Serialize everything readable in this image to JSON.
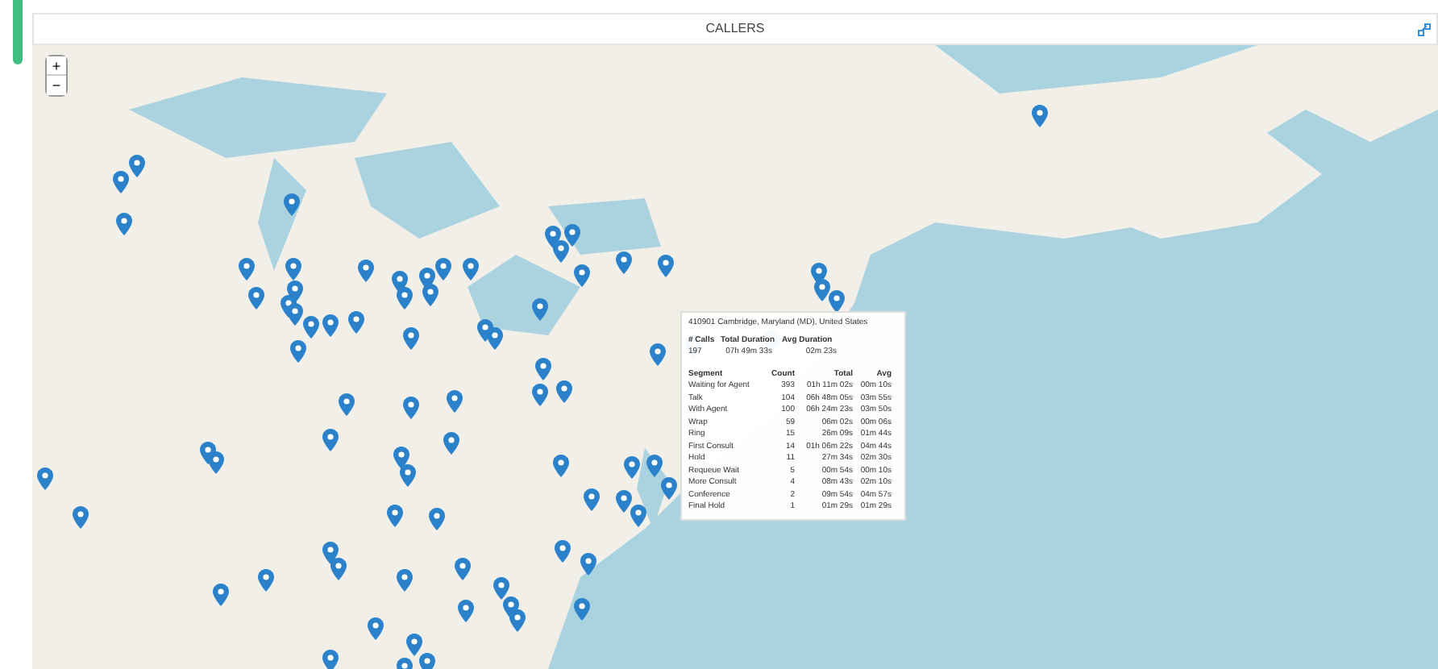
{
  "panel": {
    "title": "CALLERS"
  },
  "map_controls": [
    "+",
    "−"
  ],
  "tooltip": {
    "location": "410901 Cambridge, Maryland (MD), United States",
    "summary_columns": [
      "# Calls",
      "Total Duration",
      "Avg Duration"
    ],
    "summary_values": [
      "197",
      "07h 49m 33s",
      "02m 23s"
    ],
    "segment_columns": [
      "Segment",
      "Count",
      "Total",
      "Avg"
    ],
    "segments": [
      [
        "Waiting for Agent",
        "393",
        "01h 11m 02s",
        "00m 10s"
      ],
      [
        "Talk",
        "104",
        "06h 48m 05s",
        "03m 55s"
      ],
      [
        "With Agent",
        "100",
        "06h 24m 23s",
        "03m 50s"
      ],
      [
        "Wrap",
        "59",
        "06m 02s",
        "00m 06s"
      ],
      [
        "Ring",
        "15",
        "26m 09s",
        "01m 44s"
      ],
      [
        "First Consult",
        "14",
        "01h 06m 22s",
        "04m 44s"
      ],
      [
        "Hold",
        "11",
        "27m 34s",
        "02m 30s"
      ],
      [
        "Requeue Wait",
        "5",
        "00m 54s",
        "00m 10s"
      ],
      [
        "More Consult",
        "4",
        "08m 43s",
        "02m 10s"
      ],
      [
        "Conference",
        "2",
        "09m 54s",
        "04m 57s"
      ],
      [
        "Final Hold",
        "1",
        "01m 29s",
        "01m 29s"
      ]
    ]
  }
}
